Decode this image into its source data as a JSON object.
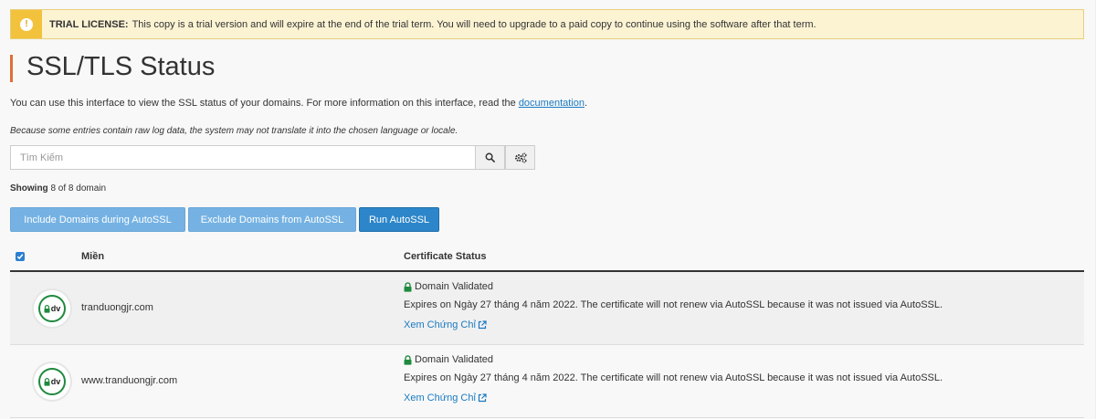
{
  "trial": {
    "label": "TRIAL LICENSE:",
    "text": "This copy is a trial version and will expire at the end of the trial term. You will need to upgrade to a paid copy to continue using the software after that term.",
    "icon": "exclamation-icon"
  },
  "page": {
    "title": "SSL/TLS Status",
    "description": "You can use this interface to view the SSL status of your domains. For more information on this interface, read the ",
    "doc_link": "documentation",
    "description_end": ".",
    "note": "Because some entries contain raw log data, the system may not translate it into the chosen language or locale."
  },
  "search": {
    "placeholder": "Tìm Kiếm",
    "value": ""
  },
  "showing": {
    "label": "Showing",
    "text": "8 of 8 domain"
  },
  "actions": {
    "include": "Include Domains during AutoSSL",
    "exclude": "Exclude Domains from AutoSSL",
    "run": "Run AutoSSL"
  },
  "table": {
    "col_domain": "Miền",
    "col_status": "Certificate Status",
    "rows": [
      {
        "badge": "dv",
        "domain": "tranduongjr.com",
        "status": "Domain Validated",
        "expires": "Expires on Ngày 27 tháng 4 năm 2022. The certificate will not renew via AutoSSL because it was not issued via AutoSSL.",
        "link": "Xem Chứng Chỉ"
      },
      {
        "badge": "dv",
        "domain": "www.tranduongjr.com",
        "status": "Domain Validated",
        "expires": "Expires on Ngày 27 tháng 4 năm 2022. The certificate will not renew via AutoSSL because it was not issued via AutoSSL.",
        "link": "Xem Chứng Chỉ"
      }
    ]
  },
  "colors": {
    "accent": "#e16e35",
    "link": "#1a7ac2",
    "primary_button": "#2d86c9",
    "light_button": "#75b2e3",
    "valid_green": "#1e8a3e",
    "warning": "#f2c23c"
  }
}
